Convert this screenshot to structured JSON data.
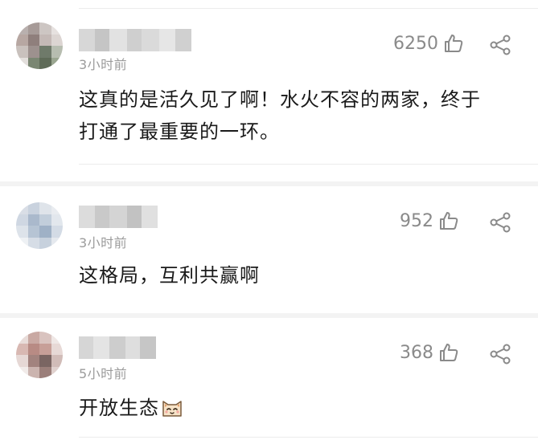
{
  "comments": [
    {
      "time": "3小时前",
      "likes": "6250",
      "text_line1": "这真的是活久见了啊！水火不容的两家，终于",
      "text_line2": "打通了最重要的一环。",
      "like_icon": "thumbs-up-icon",
      "share_icon": "share-icon"
    },
    {
      "time": "3小时前",
      "likes": "952",
      "text_line1": "这格局，互利共赢啊",
      "like_icon": "thumbs-up-icon",
      "share_icon": "share-icon"
    },
    {
      "time": "5小时前",
      "likes": "368",
      "text_line1": "开放生态",
      "emoji": "cat-face-emoji",
      "like_icon": "thumbs-up-icon",
      "share_icon": "share-icon"
    }
  ],
  "colors": {
    "text": "#1a1a1a",
    "muted": "#9b9b9b",
    "icon": "#8a8a8a",
    "divider": "#ececec"
  }
}
